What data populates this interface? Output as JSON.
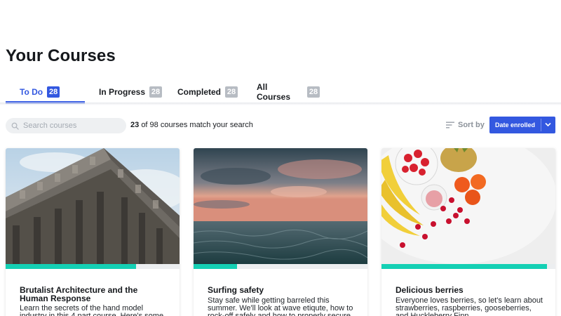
{
  "page": {
    "title": "Your Courses"
  },
  "tabs": [
    {
      "label": "To Do",
      "count": "28",
      "active": true
    },
    {
      "label": "In Progress",
      "count": "28",
      "active": false
    },
    {
      "label": "Completed",
      "count": "28",
      "active": false
    },
    {
      "label": "All Courses",
      "count": "28",
      "active": false
    }
  ],
  "search": {
    "placeholder": "Search courses",
    "value": ""
  },
  "results": {
    "matched": "23",
    "summary": "of 98 courses match your search"
  },
  "sort": {
    "label": "Sort by",
    "selected": "Date enrolled"
  },
  "courses": [
    {
      "title": "Brutalist Architecture and the Human Response",
      "description": "Learn the secrets of the hand model industry in this 4 part course. Here's some more text",
      "progress": 0.75,
      "image": "brutalist-building-photo"
    },
    {
      "title": "Surfing safety",
      "description": "Stay safe while getting barreled this summer. We'll look at wave etiqute, how to rock-off safely and how to properly secure your",
      "progress": 0.25,
      "image": "ocean-sunset-photo"
    },
    {
      "title": "Delicious berries",
      "description": "Everyone loves berries, so let's learn about strawberries, raspberries, gooseberries, and Huckleberry Finn",
      "progress": 0.95,
      "image": "fruit-bowl-photo"
    }
  ],
  "colors": {
    "accent": "#3358e0",
    "progress": "#14d0b4",
    "badge_inactive": "#b7bcc3"
  }
}
